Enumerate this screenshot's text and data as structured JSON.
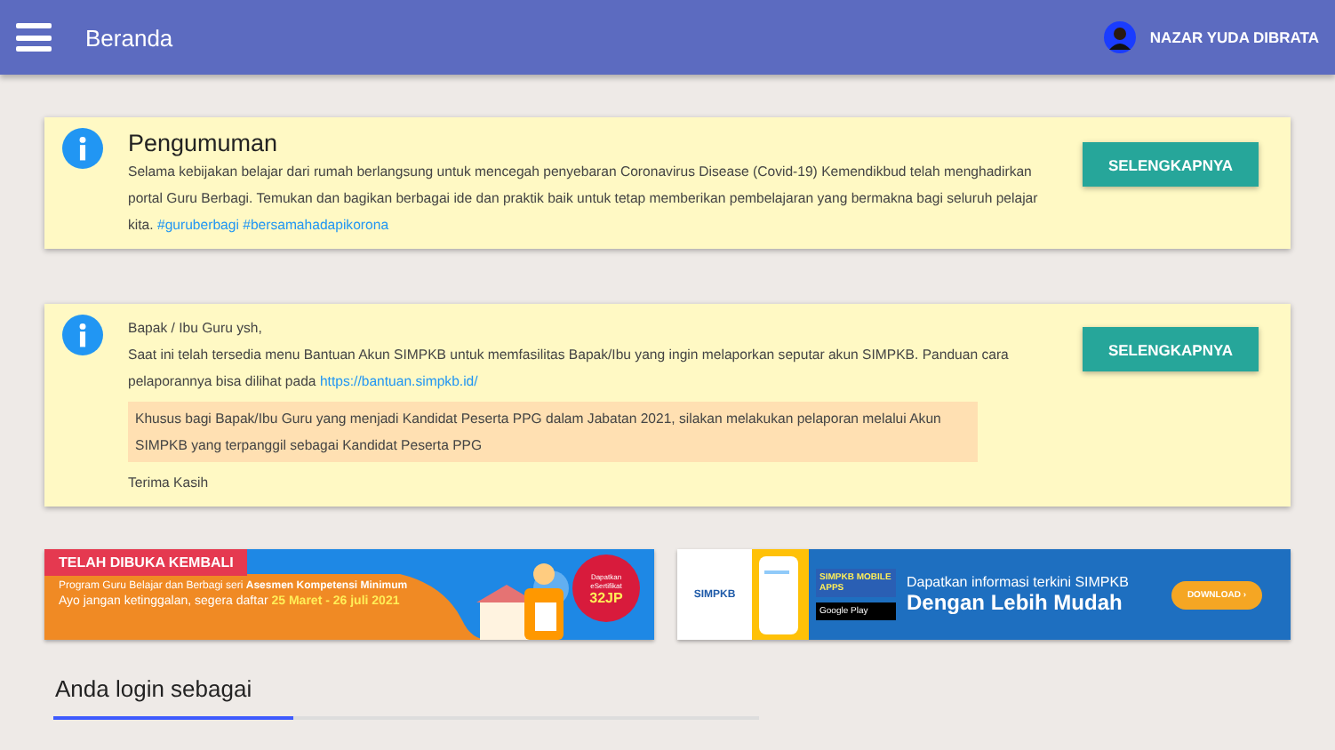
{
  "header": {
    "title": "Beranda",
    "user_name": "NAZAR YUDA DIBRATA"
  },
  "announcements": [
    {
      "kind": "titled",
      "title": "Pengumuman",
      "text": "Selama kebijakan belajar dari rumah berlangsung untuk mencegah penyebaran Coronavirus Disease (Covid-19) Kemendikbud telah menghadirkan portal Guru Berbagi. Temukan dan bagikan berbagai ide dan praktik baik untuk tetap memberikan pembelajaran yang bermakna bagi seluruh pelajar kita.",
      "tags": "#guruberbagi #bersamahadapikorona",
      "button": "SELENGKAPNYA"
    },
    {
      "kind": "letter",
      "greeting": "Bapak / Ibu Guru ysh,",
      "text": "Saat ini telah tersedia menu Bantuan Akun SIMPKB untuk memfasilitas Bapak/Ibu yang ingin melaporkan seputar akun SIMPKB. Panduan cara pelaporannya bisa dilihat pada",
      "link": "https://bantuan.simpkb.id/",
      "notice": "Khusus bagi Bapak/Ibu Guru yang menjadi Kandidat Peserta PPG dalam Jabatan 2021, silakan melakukan pelaporan melalui Akun SIMPKB yang terpanggil sebagai Kandidat Peserta PPG",
      "closing": "Terima Kasih",
      "button": "SELENGKAPNYA"
    }
  ],
  "banners": [
    {
      "kind": "program",
      "ribbon": "TELAH DIBUKA KEMBALI",
      "line1": "Program Guru Belajar dan Berbagi seri **Asesmen Kompetensi Minimum**",
      "line2": "Ayo jangan ketinggalan, segera daftar",
      "dates": "25 Maret - 26 juli 2021",
      "seal_top": "Dapatkan eSertifikat",
      "seal_value": "32JP"
    },
    {
      "kind": "app",
      "logo": "SIMPKB",
      "app_label": "SIMPKB MOBILE APPS",
      "store": "Google Play",
      "line1": "Dapatkan informasi terkini SIMPKB",
      "line2": "Dengan Lebih Mudah",
      "button": "DOWNLOAD ›"
    }
  ],
  "login_section": {
    "title": "Anda login sebagai"
  }
}
